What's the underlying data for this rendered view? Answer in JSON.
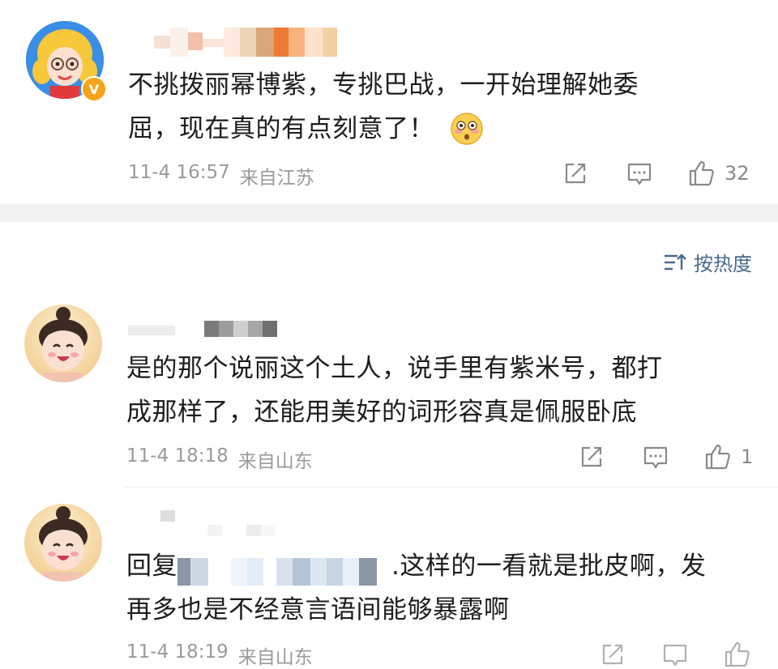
{
  "post": {
    "author_name_masked": "",
    "content": "不挑拨丽幂博紫，专挑巴战，一开始理解她委屈，现在真的有点刻意了！",
    "content_line1": "不挑拨丽幂博紫，专挑巴战，一开始理解她委",
    "content_line2": "屈，现在真的有点刻意了！",
    "emoji": "😳",
    "time": "11-4 16:57",
    "location": "来自江苏",
    "likes": "32",
    "verified_badge": "V"
  },
  "sort": {
    "label": "按热度"
  },
  "comments": [
    {
      "line1": "是的那个说丽这个土人，说手里有紫米号，都打",
      "line2": "成那样了，还能用美好的词形容真是佩服卧底",
      "time": "11-4 18:18",
      "location": "来自山东",
      "likes": "1"
    },
    {
      "reply_prefix": "回复",
      "line1_suffix": ".这样的一看就是批皮啊，发",
      "line2": "再多也是不经意言语间能够暴露啊",
      "time": "11-4 18:19",
      "location": "来自山东"
    }
  ],
  "colors": {
    "accent": "#4a6a8c",
    "meta": "#9a9a9a",
    "divider": "#f2f2f2"
  },
  "icons": [
    "share-icon",
    "comment-icon",
    "like-icon",
    "sort-icon"
  ]
}
